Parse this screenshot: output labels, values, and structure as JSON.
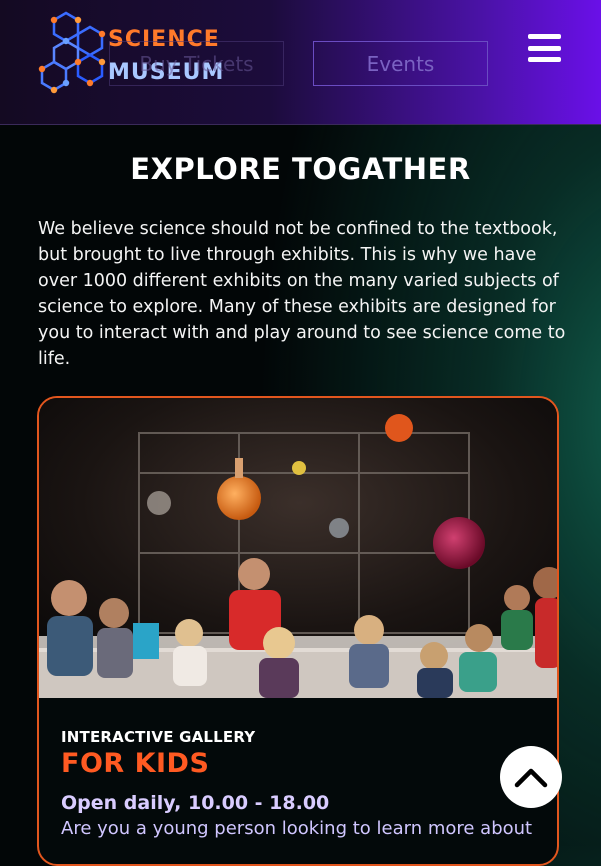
{
  "header": {
    "logo": {
      "line1": "SCIENCE",
      "line2": "MUSEUM"
    },
    "nav": {
      "tickets_label": "Buy Tickets",
      "events_label": "Events"
    },
    "menu_icon": "hamburger-icon"
  },
  "main": {
    "title": "EXPLORE TOGATHER",
    "intro": "We believe science should not be confined to the textbook, but brought to live through exhibits. This is why we have over 1000 different exhibits on the many varied subjects of science to explore. Many of these exhibits are designed for you to interact with and play around to see science come to life."
  },
  "card": {
    "kicker": "INTERACTIVE GALLERY",
    "title": "FOR KIDS",
    "hours": "Open daily, 10.00 - 18.00",
    "description": "Are you a young person looking to learn more about"
  },
  "scroll_top_icon": "chevron-up-icon",
  "colors": {
    "accent_orange": "#ff5a22",
    "header_purple": "#6a10e8",
    "lavender_text": "#d9ccff"
  }
}
